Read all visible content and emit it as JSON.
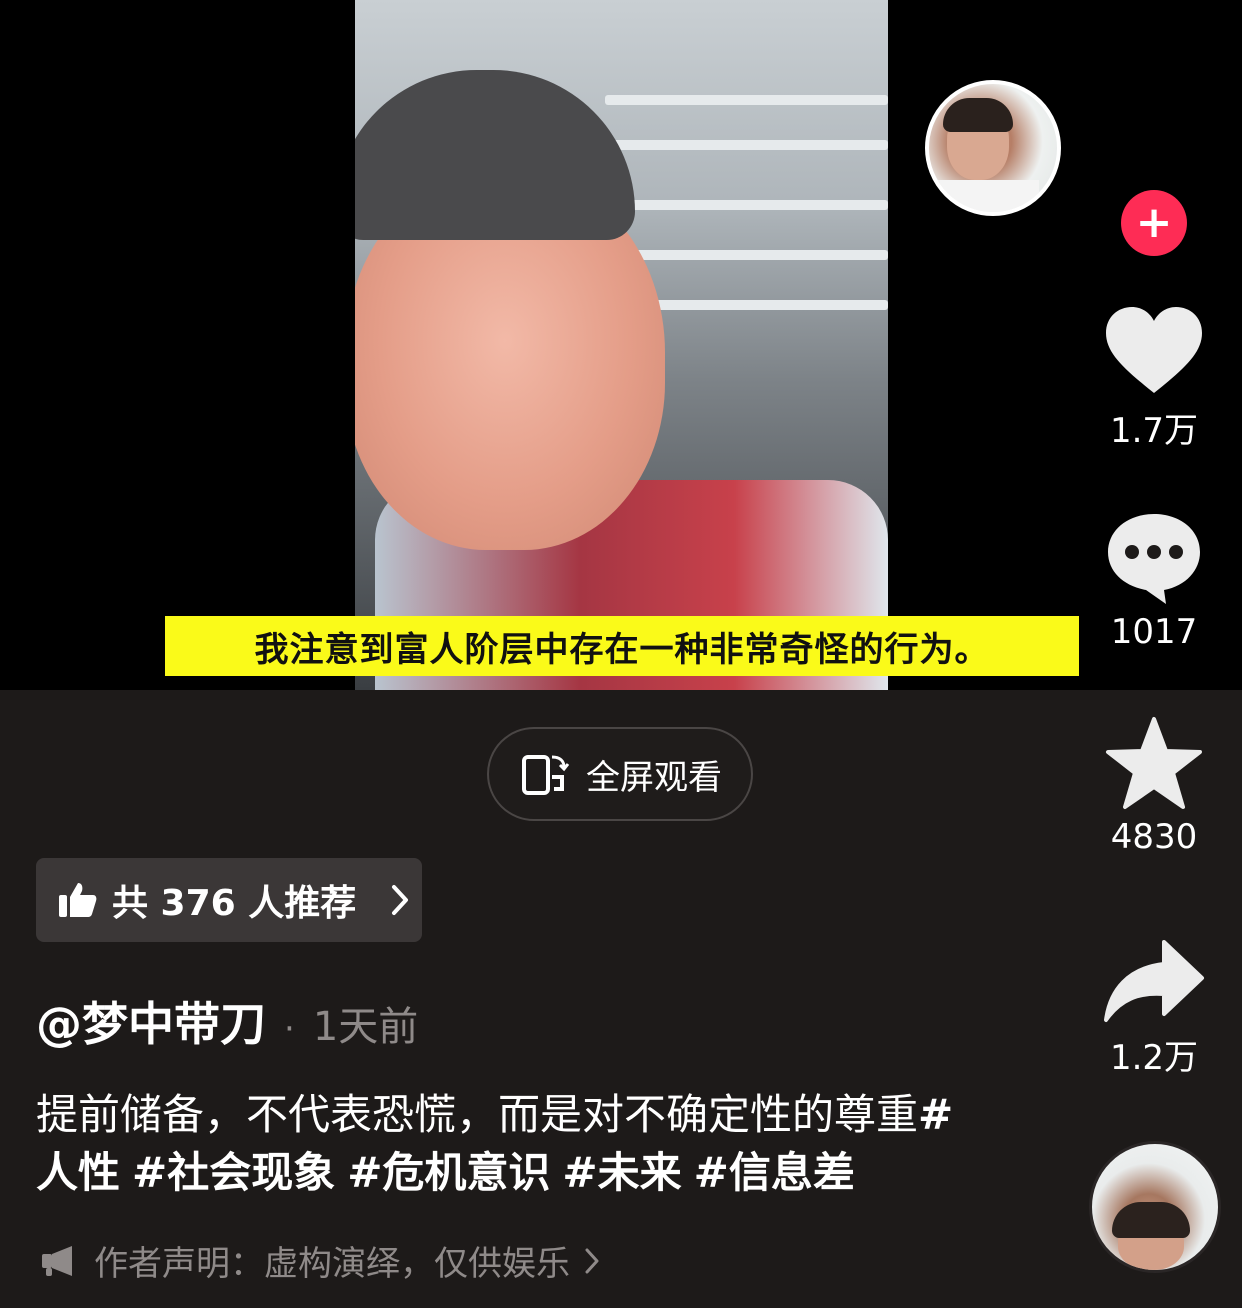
{
  "video": {
    "subtitle": "我注意到富人阶层中存在一种非常奇怪的行为。"
  },
  "rail": {
    "like_count": "1.7万",
    "comment_count": "1017",
    "favorite_count": "4830",
    "share_count": "1.2万",
    "follow_symbol": "+"
  },
  "fullscreen": {
    "label": "全屏观看"
  },
  "recommend": {
    "label": "共 376 人推荐"
  },
  "post": {
    "author": "@梦中带刀",
    "separator": "·",
    "time": "1天前",
    "caption": "提前储备，不代表恐慌，而是对不确定性的尊重",
    "tags": [
      "#人性",
      "#社会现象",
      "#危机意识",
      "#未来",
      "#信息差"
    ],
    "disclaimer": "作者声明：虚构演绎，仅供娱乐"
  },
  "icons": {
    "like": "heart-icon",
    "comment": "comment-icon",
    "favorite": "star-icon",
    "share": "share-icon",
    "fullscreen": "fullscreen-icon",
    "recommend": "thumbs-up-icon",
    "disclaimer": "megaphone-icon"
  },
  "colors": {
    "background": "#1d1a19",
    "subtitle_bg": "#fafa19",
    "follow": "#fe2c55",
    "muted_text": "#8f8a89",
    "chip_bg": "#3b3737",
    "icon": "#ececec"
  }
}
